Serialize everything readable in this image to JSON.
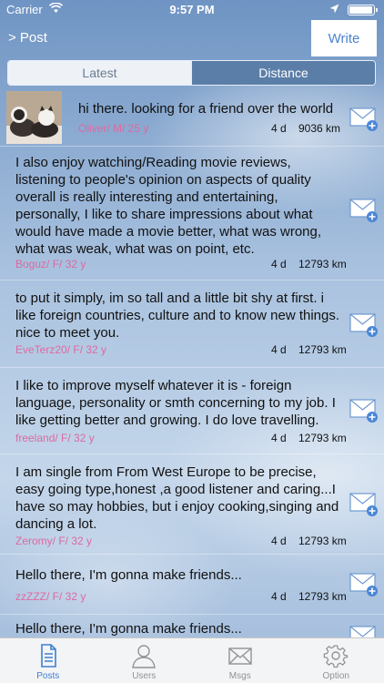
{
  "status": {
    "carrier": "Carrier",
    "time": "9:57 PM"
  },
  "nav": {
    "title": "> Post",
    "write": "Write"
  },
  "segments": {
    "latest": "Latest",
    "distance": "Distance"
  },
  "posts": [
    {
      "text": "hi there. looking for a friend over the world",
      "meta": "Oliver/ M/ 25 y",
      "age": "4 d",
      "dist": "9036 km"
    },
    {
      "text": "I also enjoy watching/Reading movie reviews, listening to people's opinion on aspects of quality overall is really interesting and entertaining, personally, I like to share impressions about what would have made a movie better, what was wrong, what was weak, what was on point, etc.",
      "meta": "Boguz/ F/ 32 y",
      "age": "4 d",
      "dist": "12793 km"
    },
    {
      "text": "to put it simply, im so tall and a little bit shy at first. i like foreign countries, culture and to know new things. nice to meet you.",
      "meta": "EveTerz20/ F/ 32 y",
      "age": "4 d",
      "dist": "12793 km"
    },
    {
      "text": "I like to improve myself whatever it is - foreign language, personality or smth concerning to my job. I like getting better and growing. I do love travelling.",
      "meta": "freeland/ F/ 32 y",
      "age": "4 d",
      "dist": "12793 km"
    },
    {
      "text": "I am single from From West Europe to be precise, easy going type,honest ,a good listener and caring...I have so may hobbies, but i enjoy cooking,singing and dancing a lot.",
      "meta": "Zeromy/ F/ 32 y",
      "age": "4 d",
      "dist": "12793 km"
    },
    {
      "text": "Hello there, I'm gonna make friends...",
      "meta": "zzZZZ/ F/ 32 y",
      "age": "4 d",
      "dist": "12793 km"
    },
    {
      "text": "Hello there, I'm gonna make friends..."
    }
  ],
  "tabs": {
    "posts": "Posts",
    "users": "Users",
    "msgs": "Msgs",
    "option": "Option"
  },
  "colors": {
    "accent": "#3f7fd1",
    "meta": "#dc6aa2"
  }
}
